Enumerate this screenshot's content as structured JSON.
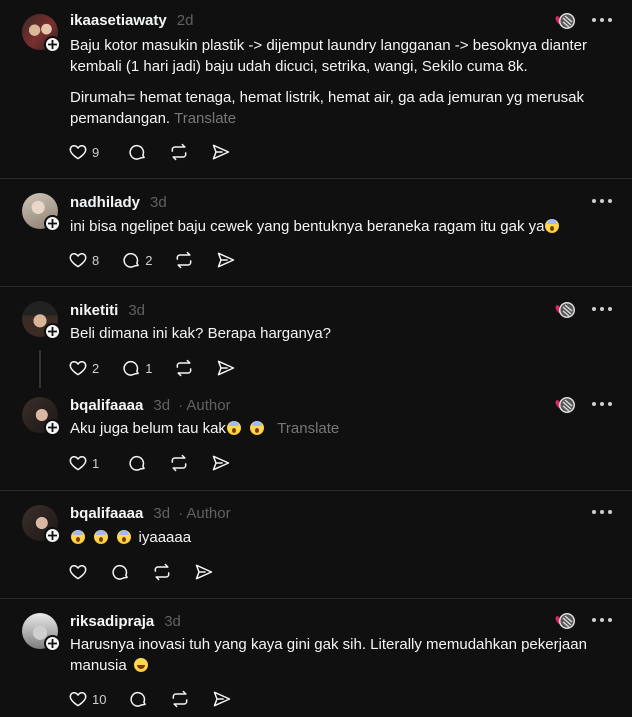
{
  "colors": {
    "bg": "#101010",
    "text": "#f3f5f7",
    "muted": "#616161",
    "divider": "#2a2a2a"
  },
  "posts": [
    {
      "username": "ikaasetiawaty",
      "time": "2d",
      "paragraph1": "Baju kotor masukin plastik -> dijemput laundry langganan -> besoknya dianter kembali (1 hari jadi) baju udah dicuci, setrika, wangi, Sekilo cuma 8k.",
      "paragraph2": "Dirumah= hemat tenaga, hemat listrik, hemat air, ga ada jemuran yg merusak pemandangan.",
      "translate": "Translate",
      "likes": "9",
      "replies": "",
      "liked_by_author": true
    },
    {
      "username": "nadhilady",
      "time": "3d",
      "paragraph1": "ini bisa ngelipet baju cewek yang bentuknya beraneka ragam itu gak ya",
      "likes": "8",
      "replies": "2",
      "liked_by_author": false
    },
    {
      "username": "niketiti",
      "time": "3d",
      "paragraph1": "Beli dimana ini kak? Berapa harganya?",
      "likes": "2",
      "replies": "1",
      "liked_by_author": true
    },
    {
      "username": "bqalifaaaa",
      "time": "3d",
      "author_tag": "· Author",
      "paragraph1": "Aku juga belum tau kak",
      "translate": "Translate",
      "likes": "1",
      "replies": "",
      "liked_by_author": true
    },
    {
      "username": "bqalifaaaa",
      "time": "3d",
      "author_tag": "· Author",
      "paragraph1": "iyaaaaa",
      "likes": "",
      "replies": "",
      "liked_by_author": false
    },
    {
      "username": "riksadipraja",
      "time": "3d",
      "paragraph1": "Harusnya inovasi tuh yang kaya gini gak sih. Literally memudahkan pekerjaan manusia",
      "likes": "10",
      "replies": "",
      "liked_by_author": true
    }
  ],
  "icons": {
    "like": "heart-icon",
    "reply": "comment-icon",
    "repost": "repost-icon",
    "share": "send-icon",
    "more": "more-icon",
    "liked_by_author": "author-liked-heart-icon",
    "follow": "plus-icon"
  }
}
